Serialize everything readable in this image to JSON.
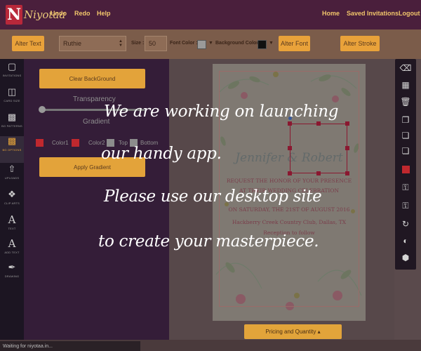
{
  "nav": {
    "logo_letter": "N",
    "logo_text": "Niyotaa",
    "undo": "Undo",
    "redo": "Redo",
    "help": "Help",
    "home": "Home",
    "saved": "Saved Invitations",
    "logout": "Logout"
  },
  "toolbar": {
    "alter_text": "Alter Text",
    "font_name": "Ruthie",
    "size_label": "Size :",
    "size_value": "50",
    "font_color_label": "Font Color :",
    "font_color": "#9a9a9a",
    "bg_color_label": "Background Color :",
    "bg_color": "#111111",
    "alter_font": "Alter Font",
    "alter_stroke": "Alter Stroke"
  },
  "sidebar": {
    "items": [
      {
        "label": "INVITATIONS",
        "icon": "monitor-icon"
      },
      {
        "label": "CARD SIZE",
        "icon": "columns-icon"
      },
      {
        "label": "BG PATTERNS",
        "icon": "image-icon"
      },
      {
        "label": "BG OPTIONS",
        "icon": "picture-icon"
      },
      {
        "label": "UPLOADS",
        "icon": "upload-icon"
      },
      {
        "label": "CLIP ARTS",
        "icon": "cubes-icon"
      },
      {
        "label": "TEXT",
        "icon": "text-icon"
      },
      {
        "label": "ADD TEXT",
        "icon": "font-icon"
      },
      {
        "label": "DRAWING",
        "icon": "brush-icon"
      }
    ]
  },
  "panel": {
    "clear_bg": "Clear BackGround",
    "transparency": "Transparency",
    "gradient": "Gradient",
    "color1": "Color1",
    "color2": "Color2",
    "top": "Top",
    "bottom": "Bottom",
    "apply_gradient": "Apply Gradient",
    "color1_swatch": "#c0282e",
    "color2_swatch": "#c0282e"
  },
  "card": {
    "names": "Jennifer & Robert",
    "line1": "REQUEST THE HONOR OF YOUR PRESENCE",
    "line2": "AT THEIR WEDDING CELEBRATION",
    "line3": "ON SATURDAY, THE 21ST OF AUGUST 2016",
    "line4": "Hackberry Creek Country Club, Dallas, TX",
    "line5": "Reception to follow"
  },
  "pricing": "Pricing and Quantity ▴",
  "status": "Waiting for niyotaa.in...",
  "overlay": {
    "line1": "We are working on launching",
    "line2": "our handy app.",
    "line3": "Please use our desktop site",
    "line4": "to create your masterpiece."
  },
  "colors": {
    "nav_bg": "#4a1f3c",
    "accent": "#e3a33a",
    "panel_bg": "#341d38"
  }
}
